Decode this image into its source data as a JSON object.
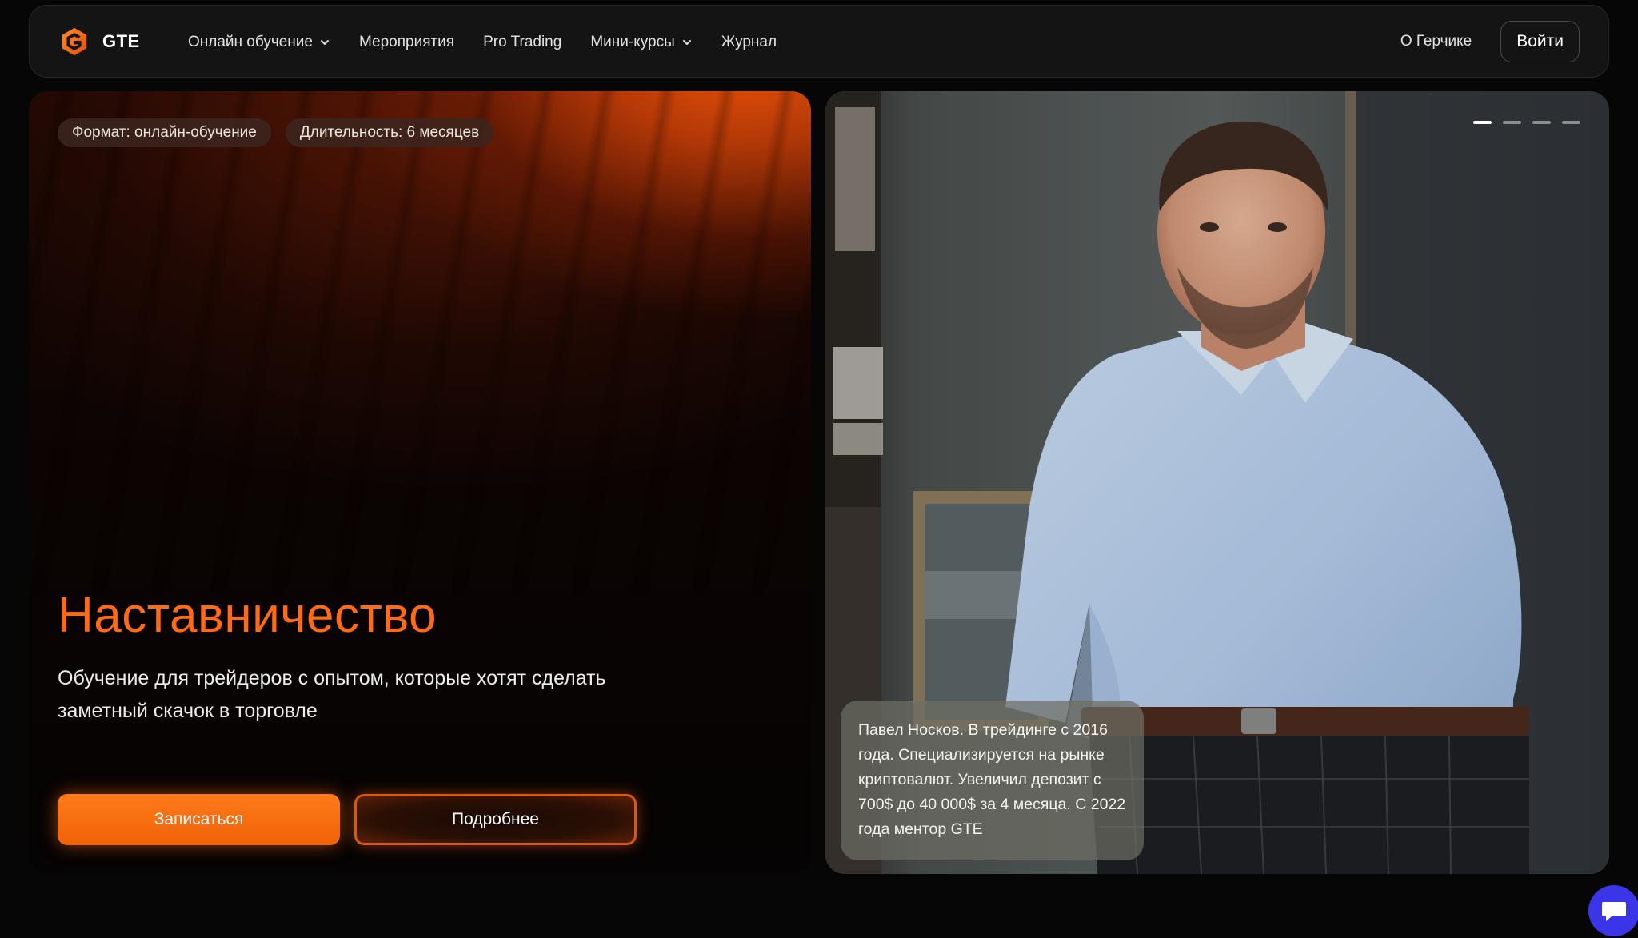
{
  "nav": {
    "logo_text": "GTE",
    "links": [
      {
        "label": "Онлайн обучение",
        "has_dropdown": true
      },
      {
        "label": "Мероприятия",
        "has_dropdown": false
      },
      {
        "label": "Pro Trading",
        "has_dropdown": false
      },
      {
        "label": "Мини-курсы",
        "has_dropdown": true
      },
      {
        "label": "Журнал",
        "has_dropdown": false
      }
    ],
    "about_label": "О Герчике",
    "login_label": "Войти"
  },
  "hero": {
    "tags": [
      "Формат: онлайн-обучение",
      "Длительность: 6 месяцев"
    ],
    "title": "Наставничество",
    "subtitle": "Обучение для трейдеров с опытом, которые хотят сделать заметный скачок в торговле",
    "primary_button": "Записаться",
    "secondary_button": "Подробнее"
  },
  "slider": {
    "slide_count": 4,
    "active_index": 0,
    "caption": "Павел Носков. В трейдинге с 2016 года. Специализируется на рынке криптовалют. Увеличил депозит с 700$ до 40 000$ за 4 месяца. С 2022 года ментор GTE"
  },
  "icons": {
    "logo": "gte-logo-icon",
    "dropdown": "chevron-down-icon",
    "chat": "chat-icon"
  },
  "colors": {
    "accent": "#FF6A14",
    "background": "#060606",
    "nav_bg": "#141414",
    "chat_widget": "#3A36E8"
  }
}
